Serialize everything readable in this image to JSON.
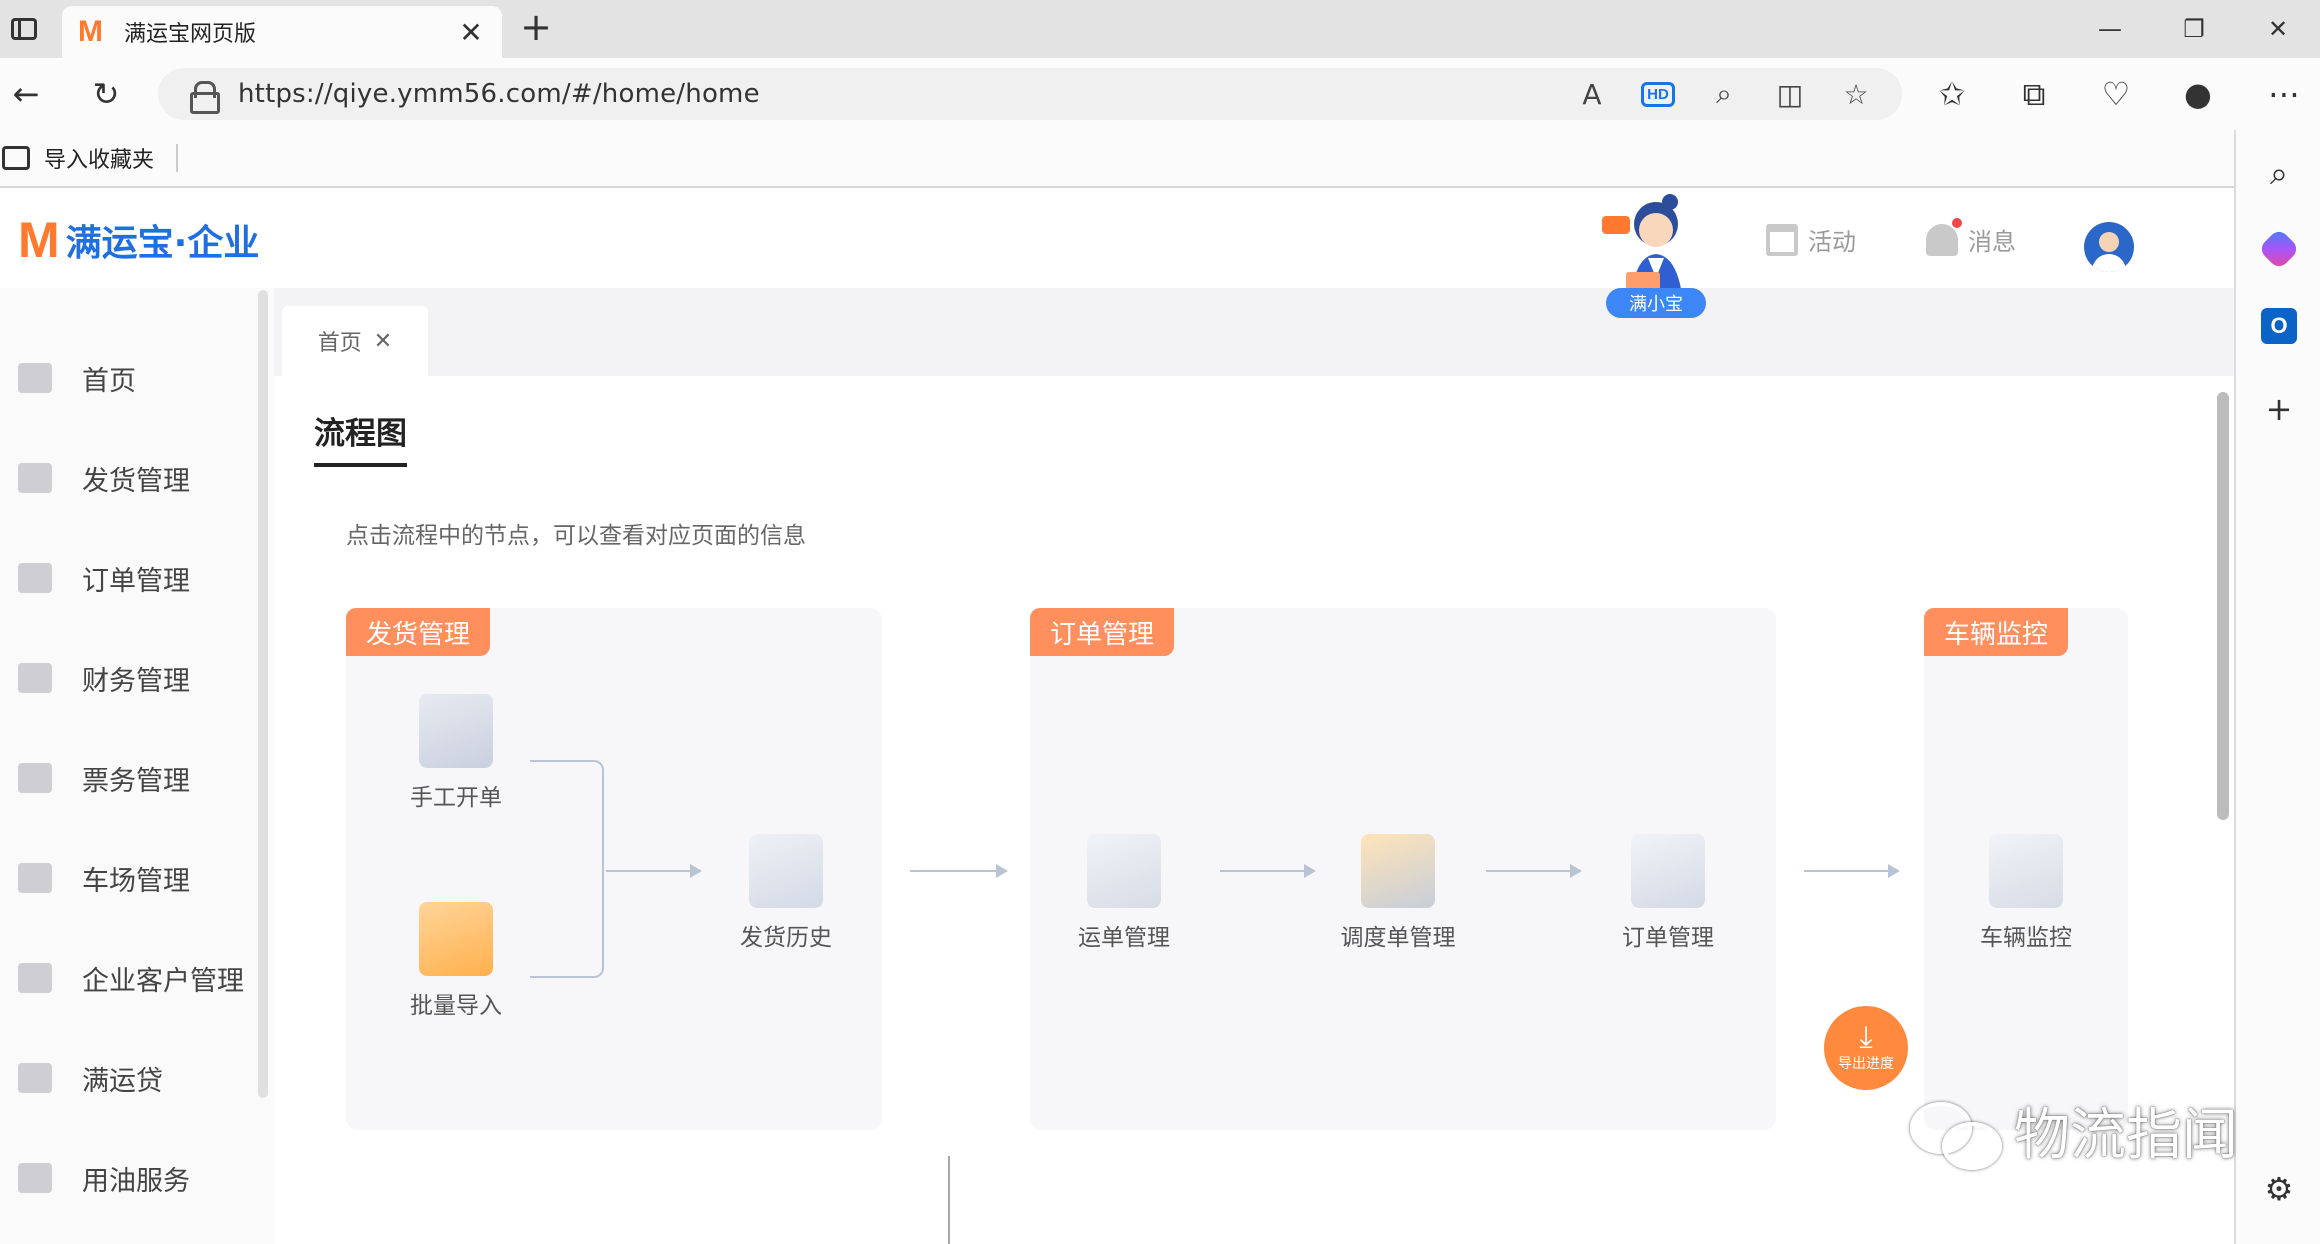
{
  "browser": {
    "tab_title": "满运宝网页版",
    "tab_favicon": "M",
    "url": "https://qiye.ymm56.com/#/home/home",
    "favorites_bar_item": "导入收藏夹"
  },
  "app": {
    "logo_mark": "M",
    "logo_text": "满运宝·企业",
    "mascot_label": "满小宝",
    "header_items": {
      "activity": "活动",
      "messages": "消息"
    },
    "accent_color": "#ff8f5c",
    "brand_color": "#1f6fe0"
  },
  "sidebar": {
    "items": [
      {
        "label": "首页",
        "icon": "home-icon"
      },
      {
        "label": "发货管理",
        "icon": "shipping-icon"
      },
      {
        "label": "订单管理",
        "icon": "order-icon"
      },
      {
        "label": "财务管理",
        "icon": "wallet-icon"
      },
      {
        "label": "票务管理",
        "icon": "ticket-icon"
      },
      {
        "label": "车场管理",
        "icon": "truck-icon"
      },
      {
        "label": "企业客户管理",
        "icon": "customer-icon"
      },
      {
        "label": "满运贷",
        "icon": "loan-icon"
      },
      {
        "label": "用油服务",
        "icon": "fuel-icon"
      }
    ]
  },
  "tabs": [
    {
      "label": "首页",
      "close": "✕"
    }
  ],
  "flowchart": {
    "title": "流程图",
    "hint": "点击流程中的节点，可以查看对应页面的信息",
    "groups": [
      {
        "tag": "发货管理",
        "nodes": [
          "手工开单",
          "批量导入",
          "发货历史"
        ]
      },
      {
        "tag": "订单管理",
        "nodes": [
          "运单管理",
          "调度单管理",
          "订单管理"
        ]
      },
      {
        "tag": "车辆监控",
        "nodes": [
          "车辆监控"
        ]
      }
    ],
    "export_label": "导出进度"
  },
  "watermark": "物流指闻"
}
